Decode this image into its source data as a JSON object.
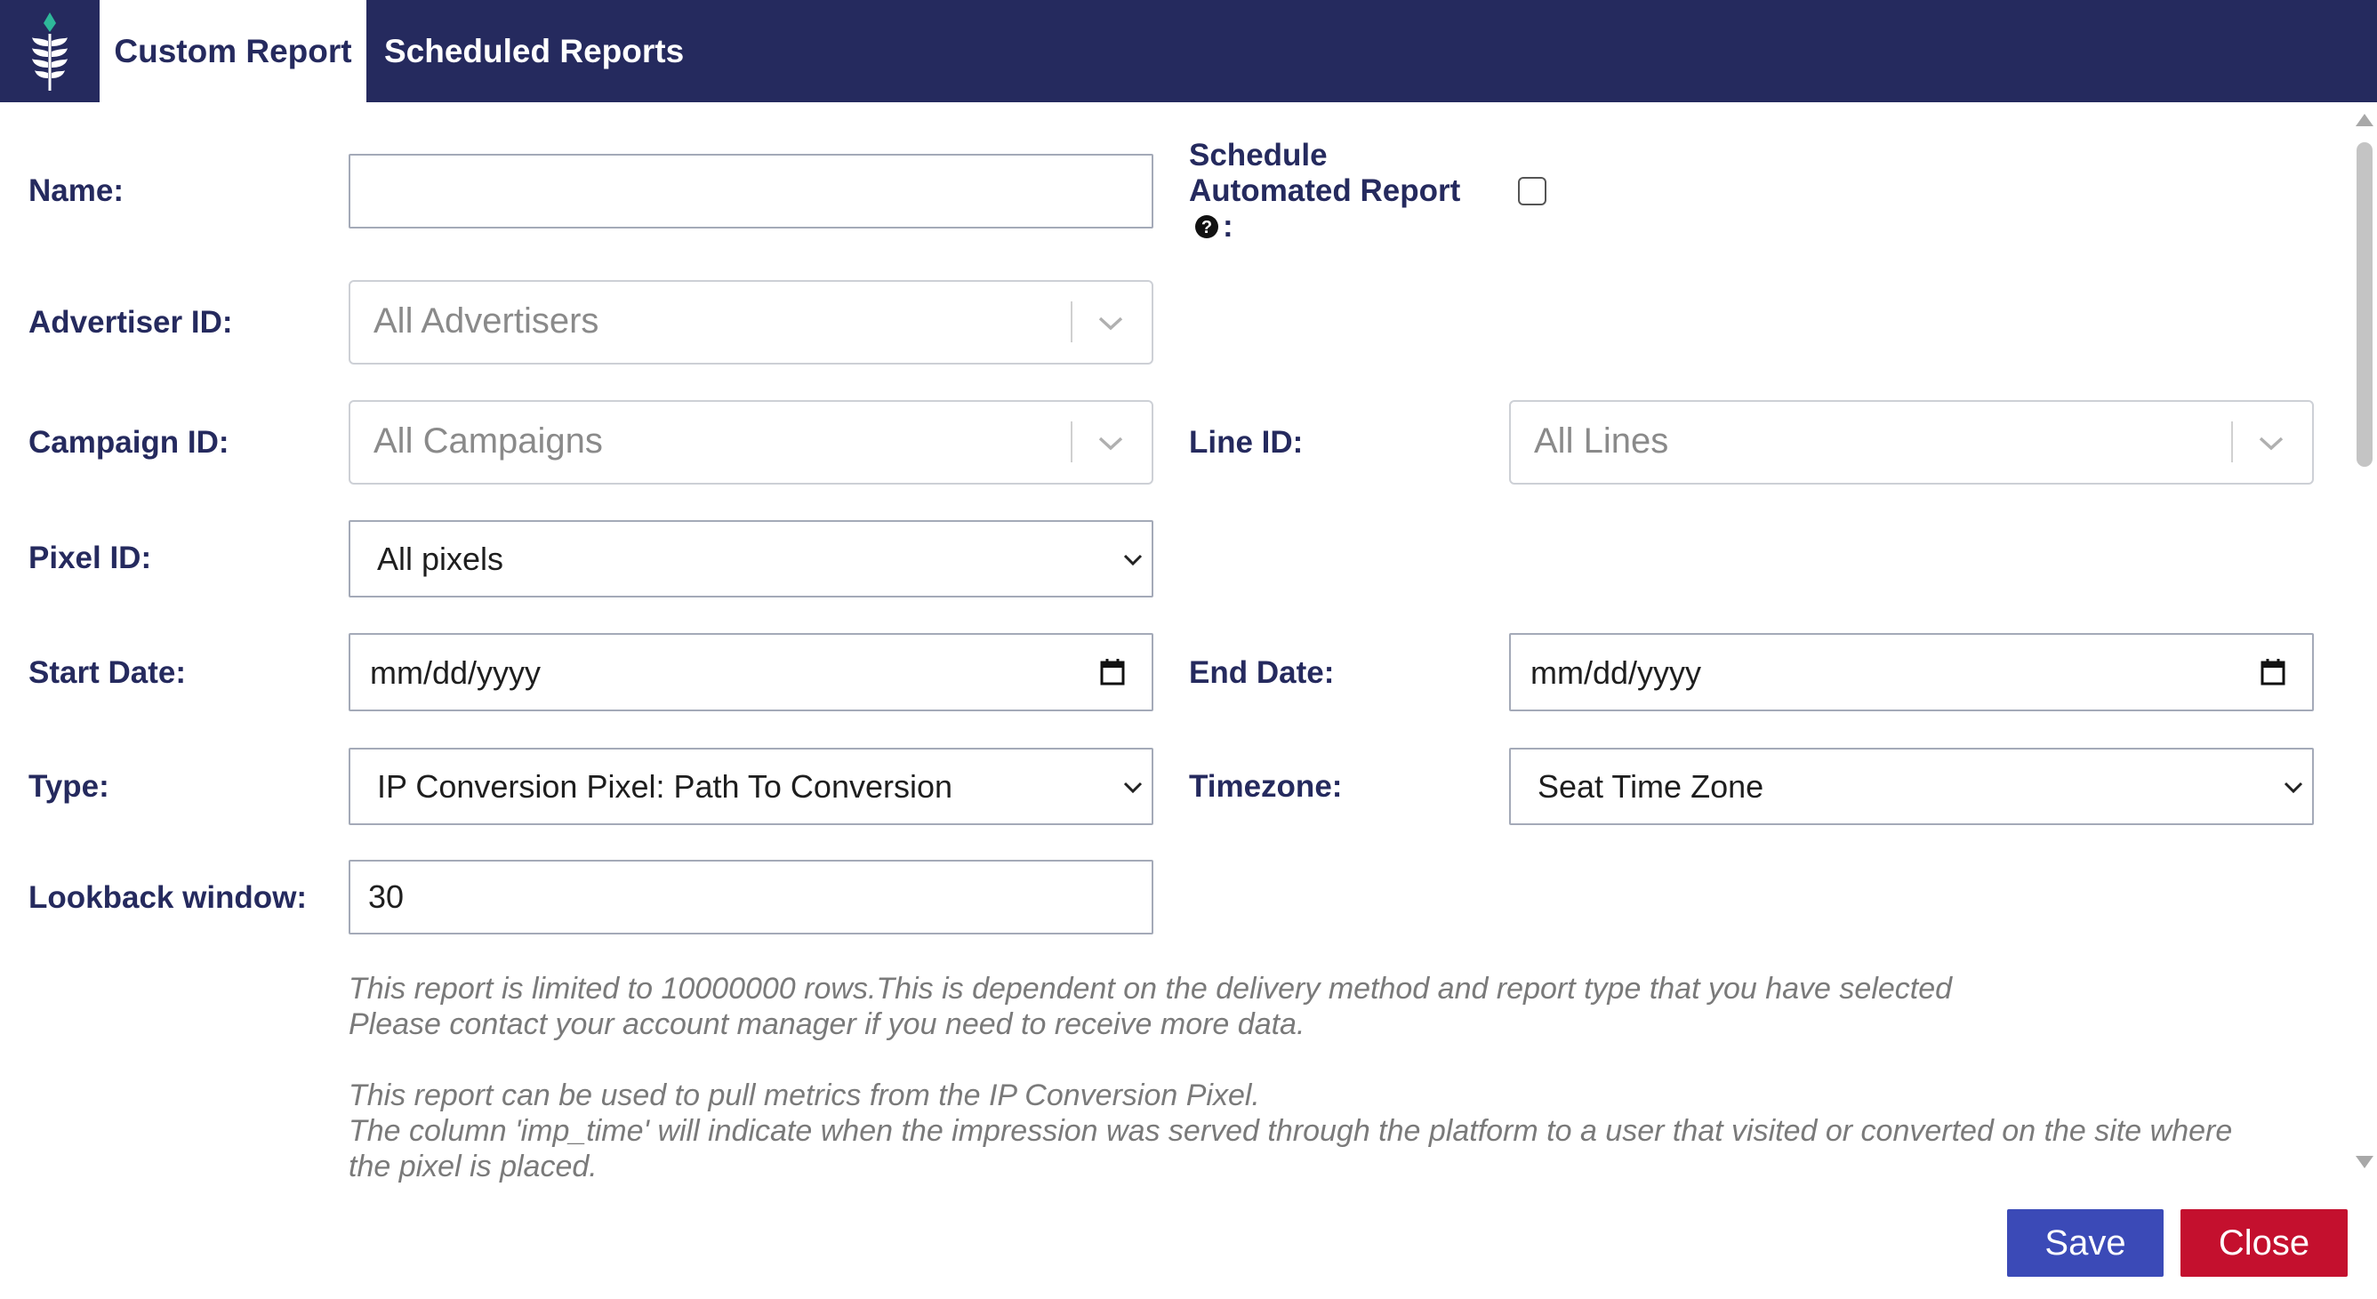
{
  "tabs": {
    "custom_report": "Custom Report",
    "scheduled_reports": "Scheduled Reports"
  },
  "form": {
    "name_label": "Name:",
    "name_value": "",
    "schedule_label_1": "Schedule",
    "schedule_label_2": "Automated Report",
    "schedule_colon": ":",
    "schedule_checked": false,
    "advertiser_label": "Advertiser ID:",
    "advertiser_placeholder": "All Advertisers",
    "campaign_label": "Campaign ID:",
    "campaign_placeholder": "All Campaigns",
    "line_label": "Line ID:",
    "line_placeholder": "All Lines",
    "pixel_label": "Pixel ID:",
    "pixel_value": "All pixels",
    "start_label": "Start Date:",
    "start_value": "mm/dd/yyyy",
    "end_label": "End Date:",
    "end_value": "mm/dd/yyyy",
    "type_label": "Type:",
    "type_value": "IP Conversion Pixel: Path To Conversion",
    "timezone_label": "Timezone:",
    "timezone_value": "Seat Time Zone",
    "lookback_label": "Lookback window:",
    "lookback_value": "30"
  },
  "notes": {
    "line1": "This report is limited to 10000000 rows.This is dependent on the delivery method and report type that you have selected",
    "line2": "Please contact your account manager if you need to receive more data.",
    "line3": "This report can be used to pull metrics from the IP Conversion Pixel.",
    "line4": "The column 'imp_time' will indicate when the impression was served through the platform to a user that visited or converted on the site where",
    "line5": "the pixel is placed."
  },
  "buttons": {
    "save": "Save",
    "close": "Close"
  },
  "colors": {
    "header": "#252a5e",
    "label": "#252a5e",
    "save": "#3b4ab7",
    "close": "#c4102e",
    "logo_accent": "#2eb89a"
  }
}
